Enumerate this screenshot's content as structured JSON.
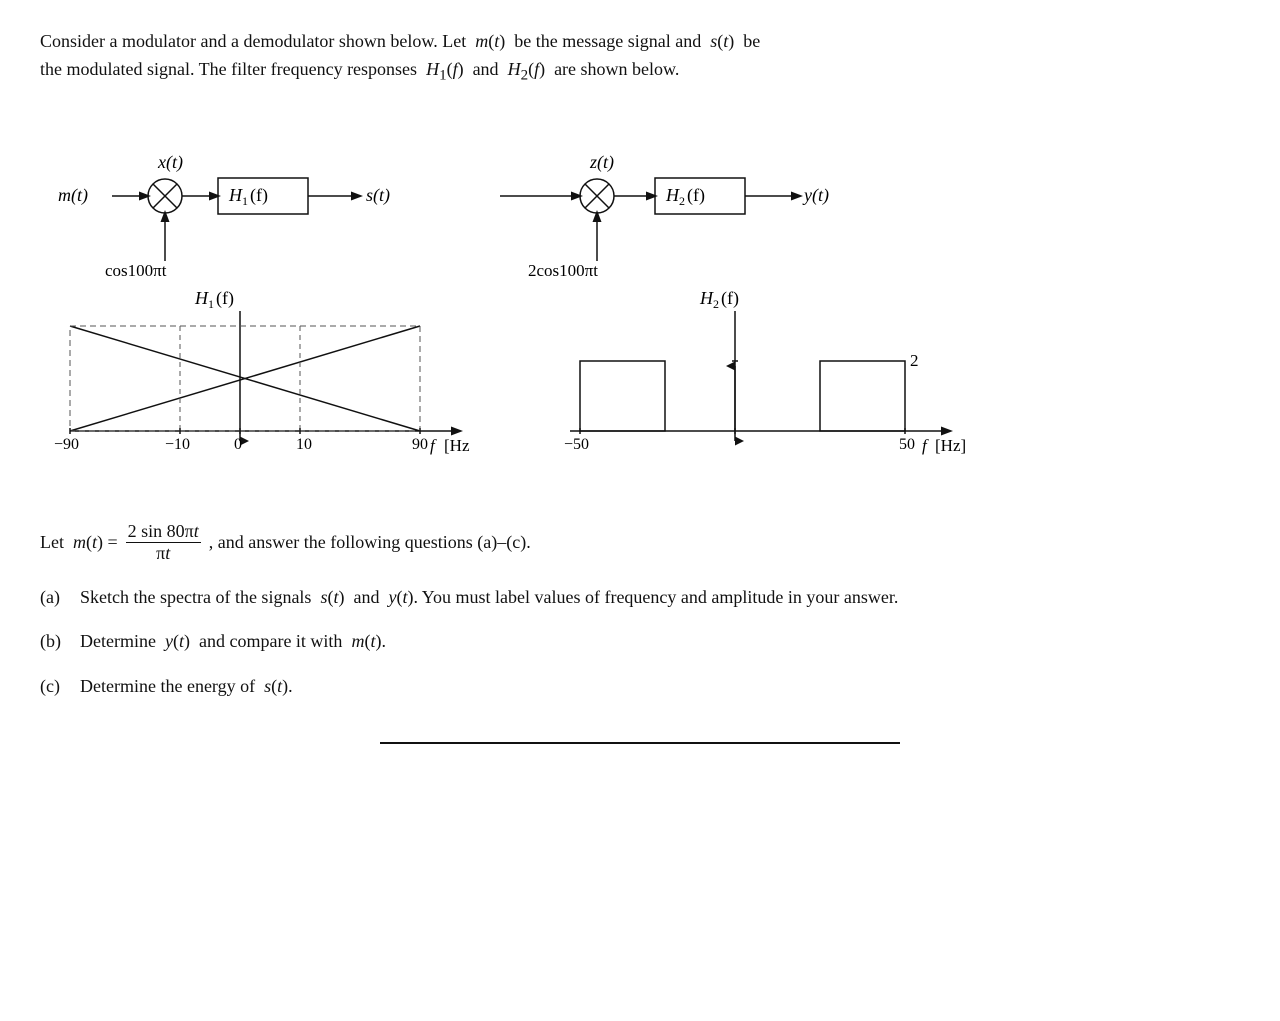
{
  "intro": {
    "line1": "Consider a modulator and a demodulator shown below. Let  m(t)  be the message signal and  s(t)  be",
    "line2": "the modulated signal. The filter frequency responses  H₁(f)  and  H₂(f)  are shown below."
  },
  "modulator": {
    "input_label": "m(t)",
    "x_label": "x(t)",
    "filter_label": "H₁(f)",
    "output_label": "s(t)",
    "carrier_label": "cos100πt"
  },
  "demodulator": {
    "z_label": "z(t)",
    "filter_label": "H₂(f)",
    "output_label": "y(t)",
    "carrier_label": "2cos100πt"
  },
  "h1_graph": {
    "title": "H₁(f)",
    "x_label": "f [Hz]",
    "x_ticks": [
      "-90",
      "-10",
      "0",
      "10",
      "90"
    ],
    "description": "Triangular filter from -90 to 90, zero at ±10, peak at ±90 and center dip"
  },
  "h2_graph": {
    "title": "H₂(f)",
    "x_label": "f [Hz]",
    "y_label": "2",
    "x_ticks": [
      "-50",
      "50"
    ],
    "description": "Rectangular bandpass filter at ±50, value 2"
  },
  "let_mt": {
    "prefix": "Let  m(t) =",
    "numerator": "2 sin 80πt",
    "denominator": "πt",
    "suffix": ", and answer the following questions (a)–(c)."
  },
  "questions": [
    {
      "label": "(a)",
      "text": "Sketch the spectra of the signals  s(t)  and  y(t) . You must label values of frequency and amplitude in your answer."
    },
    {
      "label": "(b)",
      "text": "Determine  y(t)  and compare it with  m(t)."
    },
    {
      "label": "(c)",
      "text": "Determine the energy of  s(t)."
    }
  ]
}
